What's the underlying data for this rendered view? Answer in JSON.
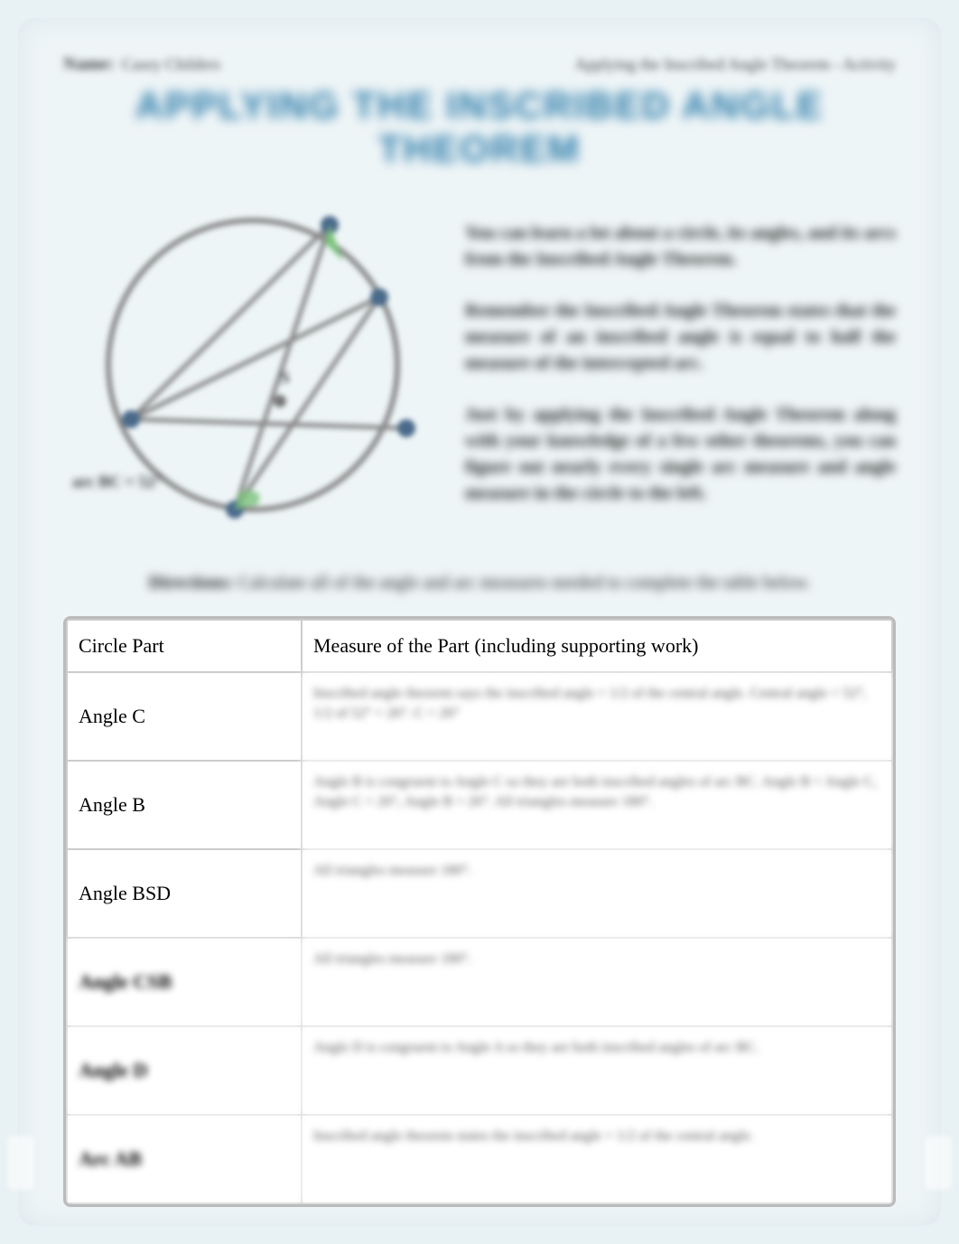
{
  "header": {
    "name_label": "Name:",
    "name_value": "Casey Childers",
    "assignment": "Applying the Inscribed Angle Theorem - Activity"
  },
  "title": "APPLYING THE INSCRIBED ANGLE THEOREM",
  "diagram": {
    "arc_label": "arc BC = 52°"
  },
  "intro": {
    "para1": "You can learn a lot about a circle, its angles, and its arcs from the Inscribed Angle Theorem.",
    "para2": "Remember the Inscribed Angle Theorem states that the measure of an inscribed angle is equal to half the measure of the intercepted arc.",
    "para3": "Just by applying the Inscribed Angle Theorem along with your knowledge of a few other theorems, you can figure out nearly every single arc measure and angle measure in the circle to the left."
  },
  "directions": {
    "label": "Directions:",
    "text": "Calculate all of the angle and arc measures needed to complete the table below."
  },
  "table": {
    "headers": {
      "col1": "Circle Part",
      "col2": "Measure of the Part (including supporting work)"
    },
    "rows": [
      {
        "part": "Angle C",
        "blurred": false,
        "measure": "Inscribed angle theorem says the inscribed angle = 1/2 of the central angle. Central angle = 52°, 1/2 of 52° = 26°. C = 26°"
      },
      {
        "part": "Angle B",
        "blurred": false,
        "measure": "Angle B is congruent to Angle C so they are both inscribed angles of arc BC. Angle B = Angle C, Angle C = 26°, Angle B = 26°. All triangles measure 180°."
      },
      {
        "part": "Angle BSD",
        "blurred": false,
        "measure": "All triangles measure 180°."
      },
      {
        "part": "Angle CSB",
        "blurred": true,
        "measure": "All triangles measure 180°."
      },
      {
        "part": "Angle D",
        "blurred": true,
        "measure": "Angle D is congruent to Angle A so they are both inscribed angles of arc BC."
      },
      {
        "part": "Arc AB",
        "blurred": true,
        "measure": "Inscribed angle theorem states the inscribed angle = 1/2 of the central angle."
      }
    ]
  }
}
